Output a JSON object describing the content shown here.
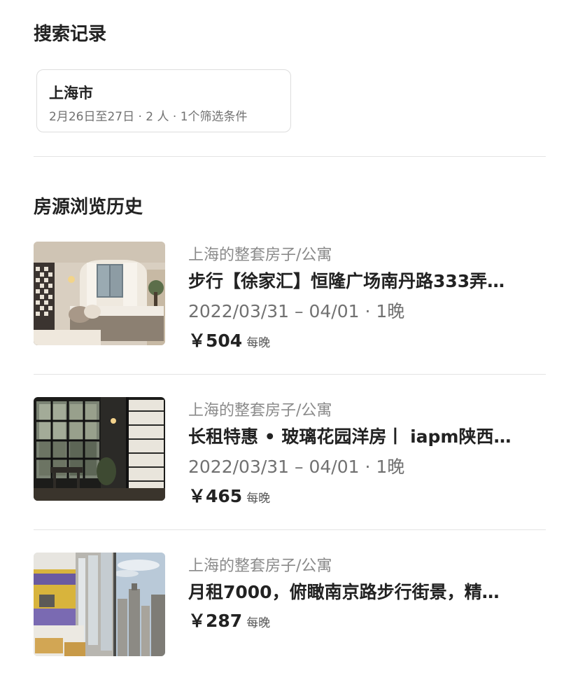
{
  "search_history": {
    "title": "搜索记录",
    "items": [
      {
        "place": "上海市",
        "details": "2月26日至27日 · 2 人 · 1个筛选条件"
      }
    ]
  },
  "browse_history": {
    "title": "房源浏览历史",
    "listings": [
      {
        "type": "上海的整套房子/公寓",
        "title": "步行【徐家汇】恒隆广场南丹路333弄…",
        "dates": "2022/03/31 – 04/01 · 1晚",
        "price": "￥504",
        "price_unit": "每晚",
        "image": "bedroom-photo"
      },
      {
        "type": "上海的整套房子/公寓",
        "title": "长租特惠 • 玻璃花园洋房丨 iapm陕西…",
        "dates": "2022/03/31 – 04/01 · 1晚",
        "price": "￥465",
        "price_unit": "每晚",
        "image": "glass-room-photo"
      },
      {
        "type": "上海的整套房子/公寓",
        "title": "月租7000，俯瞰南京路步行街景，精…",
        "price": "￥287",
        "price_unit": "每晚",
        "image": "city-view-photo"
      }
    ]
  }
}
